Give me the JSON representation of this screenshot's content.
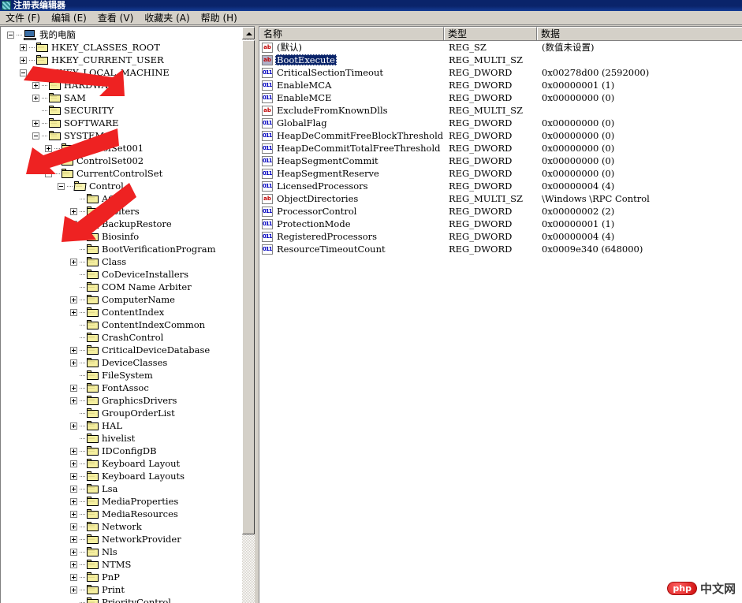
{
  "window": {
    "title": "注册表编辑器",
    "icon": "regedit-icon"
  },
  "menubar": {
    "items": [
      {
        "label": "文件 (F)"
      },
      {
        "label": "编辑 (E)"
      },
      {
        "label": "查看 (V)"
      },
      {
        "label": "收藏夹 (A)"
      },
      {
        "label": "帮助 (H)"
      }
    ]
  },
  "tree": {
    "nodes": [
      {
        "label": "我的电脑",
        "depth": 0,
        "expander": "minus",
        "icon": "computer"
      },
      {
        "label": "HKEY_CLASSES_ROOT",
        "depth": 1,
        "expander": "plus",
        "icon": "folder"
      },
      {
        "label": "HKEY_CURRENT_USER",
        "depth": 1,
        "expander": "plus",
        "icon": "folder"
      },
      {
        "label": "HKEY_LOCAL_MACHINE",
        "depth": 1,
        "expander": "minus",
        "icon": "folder"
      },
      {
        "label": "HARDWARE",
        "depth": 2,
        "expander": "plus",
        "icon": "folder"
      },
      {
        "label": "SAM",
        "depth": 2,
        "expander": "plus",
        "icon": "folder"
      },
      {
        "label": "SECURITY",
        "depth": 2,
        "expander": "none",
        "icon": "folder"
      },
      {
        "label": "SOFTWARE",
        "depth": 2,
        "expander": "plus",
        "icon": "folder"
      },
      {
        "label": "SYSTEM",
        "depth": 2,
        "expander": "minus",
        "icon": "folder"
      },
      {
        "label": "ControlSet001",
        "depth": 3,
        "expander": "plus",
        "icon": "folder"
      },
      {
        "label": "ControlSet002",
        "depth": 3,
        "expander": "plus",
        "icon": "folder"
      },
      {
        "label": "CurrentControlSet",
        "depth": 3,
        "expander": "minus",
        "icon": "folder"
      },
      {
        "label": "Control",
        "depth": 4,
        "expander": "minus",
        "icon": "folder-open"
      },
      {
        "label": "AGP",
        "depth": 5,
        "expander": "none",
        "icon": "folder"
      },
      {
        "label": "Arbiters",
        "depth": 5,
        "expander": "plus",
        "icon": "folder"
      },
      {
        "label": "BackupRestore",
        "depth": 5,
        "expander": "plus",
        "icon": "folder"
      },
      {
        "label": "Biosinfo",
        "depth": 5,
        "expander": "none",
        "icon": "folder"
      },
      {
        "label": "BootVerificationProgram",
        "depth": 5,
        "expander": "none",
        "icon": "folder"
      },
      {
        "label": "Class",
        "depth": 5,
        "expander": "plus",
        "icon": "folder"
      },
      {
        "label": "CoDeviceInstallers",
        "depth": 5,
        "expander": "none",
        "icon": "folder"
      },
      {
        "label": "COM Name Arbiter",
        "depth": 5,
        "expander": "none",
        "icon": "folder"
      },
      {
        "label": "ComputerName",
        "depth": 5,
        "expander": "plus",
        "icon": "folder"
      },
      {
        "label": "ContentIndex",
        "depth": 5,
        "expander": "plus",
        "icon": "folder"
      },
      {
        "label": "ContentIndexCommon",
        "depth": 5,
        "expander": "none",
        "icon": "folder"
      },
      {
        "label": "CrashControl",
        "depth": 5,
        "expander": "none",
        "icon": "folder"
      },
      {
        "label": "CriticalDeviceDatabase",
        "depth": 5,
        "expander": "plus",
        "icon": "folder"
      },
      {
        "label": "DeviceClasses",
        "depth": 5,
        "expander": "plus",
        "icon": "folder"
      },
      {
        "label": "FileSystem",
        "depth": 5,
        "expander": "none",
        "icon": "folder"
      },
      {
        "label": "FontAssoc",
        "depth": 5,
        "expander": "plus",
        "icon": "folder"
      },
      {
        "label": "GraphicsDrivers",
        "depth": 5,
        "expander": "plus",
        "icon": "folder"
      },
      {
        "label": "GroupOrderList",
        "depth": 5,
        "expander": "none",
        "icon": "folder"
      },
      {
        "label": "HAL",
        "depth": 5,
        "expander": "plus",
        "icon": "folder"
      },
      {
        "label": "hivelist",
        "depth": 5,
        "expander": "none",
        "icon": "folder"
      },
      {
        "label": "IDConfigDB",
        "depth": 5,
        "expander": "plus",
        "icon": "folder"
      },
      {
        "label": "Keyboard Layout",
        "depth": 5,
        "expander": "plus",
        "icon": "folder"
      },
      {
        "label": "Keyboard Layouts",
        "depth": 5,
        "expander": "plus",
        "icon": "folder"
      },
      {
        "label": "Lsa",
        "depth": 5,
        "expander": "plus",
        "icon": "folder"
      },
      {
        "label": "MediaProperties",
        "depth": 5,
        "expander": "plus",
        "icon": "folder"
      },
      {
        "label": "MediaResources",
        "depth": 5,
        "expander": "plus",
        "icon": "folder"
      },
      {
        "label": "Network",
        "depth": 5,
        "expander": "plus",
        "icon": "folder"
      },
      {
        "label": "NetworkProvider",
        "depth": 5,
        "expander": "plus",
        "icon": "folder"
      },
      {
        "label": "Nls",
        "depth": 5,
        "expander": "plus",
        "icon": "folder"
      },
      {
        "label": "NTMS",
        "depth": 5,
        "expander": "plus",
        "icon": "folder"
      },
      {
        "label": "PnP",
        "depth": 5,
        "expander": "plus",
        "icon": "folder"
      },
      {
        "label": "Print",
        "depth": 5,
        "expander": "plus",
        "icon": "folder"
      },
      {
        "label": "PriorityControl",
        "depth": 5,
        "expander": "none",
        "icon": "folder"
      }
    ]
  },
  "list": {
    "columns": [
      {
        "label": "名称"
      },
      {
        "label": "类型"
      },
      {
        "label": "数据"
      }
    ],
    "rows": [
      {
        "name": "(默认)",
        "type": "REG_SZ",
        "data": "(数值未设置)",
        "icon": "string-value-icon",
        "selected": false
      },
      {
        "name": "BootExecute",
        "type": "REG_MULTI_SZ",
        "data": "",
        "icon": "string-value-icon",
        "selected": true
      },
      {
        "name": "CriticalSectionTimeout",
        "type": "REG_DWORD",
        "data": "0x00278d00 (2592000)",
        "icon": "binary-value-icon",
        "selected": false
      },
      {
        "name": "EnableMCA",
        "type": "REG_DWORD",
        "data": "0x00000001 (1)",
        "icon": "binary-value-icon",
        "selected": false
      },
      {
        "name": "EnableMCE",
        "type": "REG_DWORD",
        "data": "0x00000000 (0)",
        "icon": "binary-value-icon",
        "selected": false
      },
      {
        "name": "ExcludeFromKnownDlls",
        "type": "REG_MULTI_SZ",
        "data": "",
        "icon": "string-value-icon",
        "selected": false
      },
      {
        "name": "GlobalFlag",
        "type": "REG_DWORD",
        "data": "0x00000000 (0)",
        "icon": "binary-value-icon",
        "selected": false
      },
      {
        "name": "HeapDeCommitFreeBlockThreshold",
        "type": "REG_DWORD",
        "data": "0x00000000 (0)",
        "icon": "binary-value-icon",
        "selected": false
      },
      {
        "name": "HeapDeCommitTotalFreeThreshold",
        "type": "REG_DWORD",
        "data": "0x00000000 (0)",
        "icon": "binary-value-icon",
        "selected": false
      },
      {
        "name": "HeapSegmentCommit",
        "type": "REG_DWORD",
        "data": "0x00000000 (0)",
        "icon": "binary-value-icon",
        "selected": false
      },
      {
        "name": "HeapSegmentReserve",
        "type": "REG_DWORD",
        "data": "0x00000000 (0)",
        "icon": "binary-value-icon",
        "selected": false
      },
      {
        "name": "LicensedProcessors",
        "type": "REG_DWORD",
        "data": "0x00000004 (4)",
        "icon": "binary-value-icon",
        "selected": false
      },
      {
        "name": "ObjectDirectories",
        "type": "REG_MULTI_SZ",
        "data": "\\Windows \\RPC Control",
        "icon": "string-value-icon",
        "selected": false
      },
      {
        "name": "ProcessorControl",
        "type": "REG_DWORD",
        "data": "0x00000002 (2)",
        "icon": "binary-value-icon",
        "selected": false
      },
      {
        "name": "ProtectionMode",
        "type": "REG_DWORD",
        "data": "0x00000001 (1)",
        "icon": "binary-value-icon",
        "selected": false
      },
      {
        "name": "RegisteredProcessors",
        "type": "REG_DWORD",
        "data": "0x00000004 (4)",
        "icon": "binary-value-icon",
        "selected": false
      },
      {
        "name": "ResourceTimeoutCount",
        "type": "REG_DWORD",
        "data": "0x0009e340 (648000)",
        "icon": "binary-value-icon",
        "selected": false
      }
    ]
  },
  "annotations": {
    "arrows": [
      {
        "target": "HKEY_LOCAL_MACHINE",
        "color": "#ee2222"
      },
      {
        "target": "SYSTEM",
        "color": "#ee2222"
      },
      {
        "target": "Control",
        "color": "#ee2222"
      }
    ]
  },
  "watermark": {
    "badge": "php",
    "text": "中文网"
  },
  "colors": {
    "titlebar": "#0a246a",
    "selection": "#0a246a",
    "window_face": "#d4d0c8",
    "annotation_red": "#ee2222"
  }
}
